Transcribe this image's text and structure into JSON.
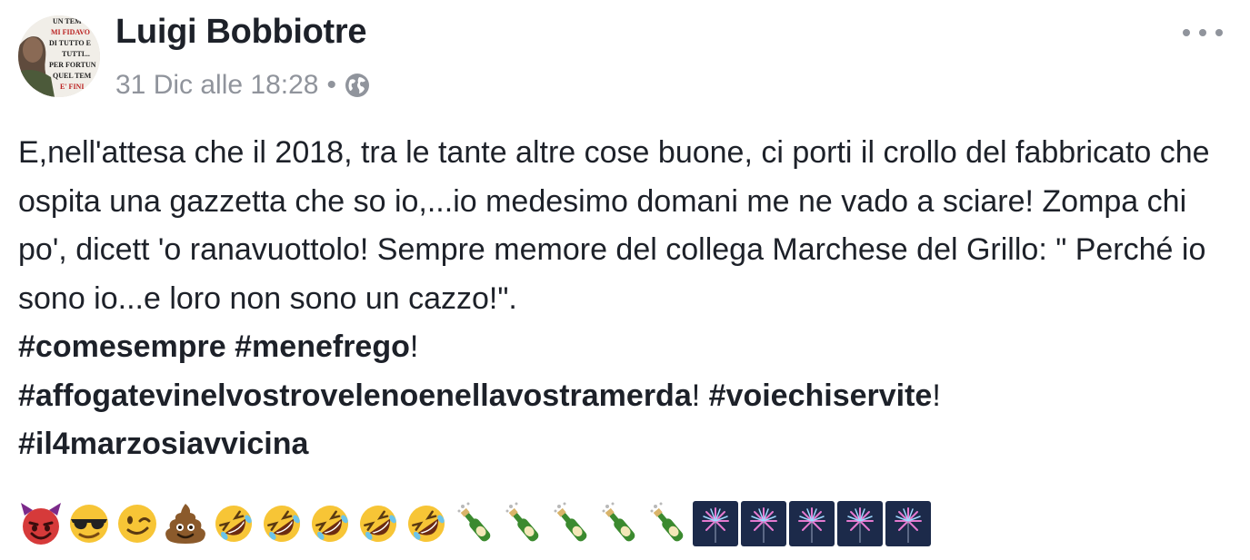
{
  "post": {
    "author": "Luigi Bobbiotre",
    "timestamp": "31 Dic alle 18:28",
    "separator": "•",
    "privacy_icon": "globe-icon",
    "menu_icon": "more-options-icon",
    "avatar_text": [
      "UN TEM",
      "MI FIDAVO",
      "DI TUTTO E",
      "TUTTI...",
      "PER FORTUN",
      "QUEL TEM",
      "E' FINI"
    ],
    "text": "E,nell'attesa che il 2018, tra le tante altre cose buone, ci porti il crollo del fabbricato che ospita una gazzetta che so io,...io medesimo domani me ne vado a sciare! Zompa chi po', dicett 'o ranavuottolo! Sempre memore del collega Marchese del Grillo: \" Perché io sono io...e loro non sono un cazzo!\".",
    "hashtags": {
      "h1": "#comesempre",
      "space1": " ",
      "h2": "#menefrego",
      "punct1": "!",
      "h3": "#affogatevinelvostrovelenoenellavostramerda",
      "punct2": "! ",
      "h4": "#voiechiservite",
      "punct3": "!",
      "h5": "#il4marzosiavvicina"
    },
    "emojis": [
      "smiling-devil-emoji",
      "sunglasses-emoji",
      "winking-face-emoji",
      "poop-emoji",
      "rofl-emoji",
      "rofl-emoji",
      "rofl-emoji",
      "rofl-emoji",
      "rofl-emoji",
      "champagne-emoji",
      "champagne-emoji",
      "champagne-emoji",
      "champagne-emoji",
      "champagne-emoji",
      "fireworks-emoji",
      "fireworks-emoji",
      "fireworks-emoji",
      "fireworks-emoji",
      "fireworks-emoji"
    ]
  },
  "colors": {
    "text": "#1d2129",
    "meta": "#90949c",
    "background": "#ffffff"
  }
}
